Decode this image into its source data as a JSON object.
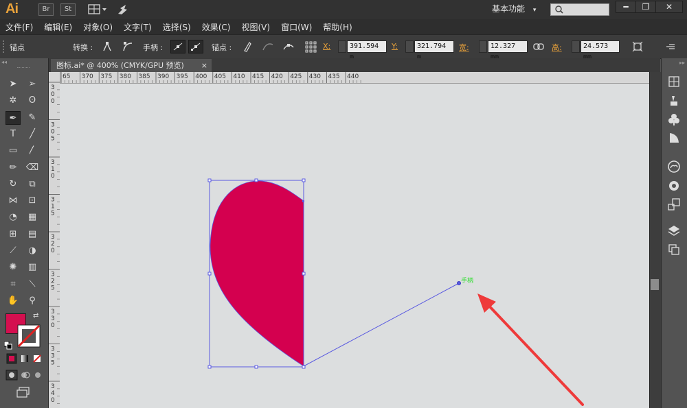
{
  "app": {
    "logo": "Ai",
    "btn_br": "Br",
    "btn_st": "St",
    "workspace": "基本功能",
    "workspace_caret": "▾"
  },
  "window_controls": {
    "minimize": "━",
    "restore": "❐",
    "close": "✕"
  },
  "menu": [
    "文件(F)",
    "编辑(E)",
    "对象(O)",
    "文字(T)",
    "选择(S)",
    "效果(C)",
    "视图(V)",
    "窗口(W)",
    "帮助(H)"
  ],
  "control_bar": {
    "selection_label": "锚点",
    "convert_label": "转换 :",
    "handles_label": "手柄 :",
    "anchors_label": "锚点 :",
    "x_label": "X:",
    "x_value": "391.594 m",
    "y_label": "Y:",
    "y_value": "321.794 m",
    "w_label": "宽:",
    "w_value": "12.327 mm",
    "h_label": "高:",
    "h_value": "24.573 mm"
  },
  "document": {
    "tab_title": "图标.ai* @ 400% (CMYK/GPU 预览)",
    "tab_close": "×"
  },
  "ruler": {
    "h_ticks": [
      "65",
      "370",
      "375",
      "380",
      "385",
      "390",
      "395",
      "400",
      "405",
      "410",
      "415",
      "420",
      "425",
      "430",
      "435",
      "440"
    ],
    "v_ticks": [
      "300",
      "305",
      "310",
      "315",
      "320",
      "325",
      "330",
      "335",
      "340"
    ]
  },
  "canvas": {
    "handle_label": "手柄",
    "shape_fill": "#d4004f",
    "selection_color": "#5a5ae0",
    "arrow_color": "#ee3a3a",
    "handle_label_color": "#33dd33"
  },
  "tools": {
    "fill_color": "#d40f4f",
    "icons": [
      "selection-tool",
      "direct-selection-tool",
      "magic-wand-tool",
      "lasso-tool",
      "pen-tool",
      "curvature-tool",
      "type-tool",
      "line-tool",
      "rectangle-tool",
      "paintbrush-tool",
      "pencil-tool",
      "eraser-tool",
      "rotate-tool",
      "scale-tool",
      "width-tool",
      "free-transform-tool",
      "shape-builder-tool",
      "perspective-grid-tool",
      "mesh-tool",
      "gradient-tool",
      "eyedropper-tool",
      "blend-tool",
      "symbol-sprayer-tool",
      "column-graph-tool",
      "artboard-tool",
      "slice-tool",
      "hand-tool",
      "zoom-tool"
    ]
  }
}
